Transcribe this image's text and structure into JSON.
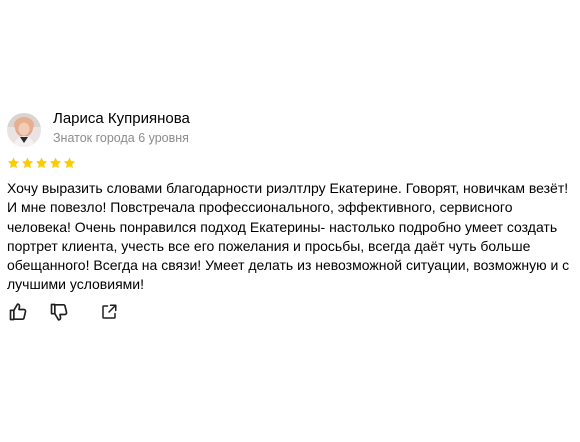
{
  "review": {
    "author": {
      "name": "Лариса Куприянова",
      "level": "Знаток города 6 уровня"
    },
    "rating": 5,
    "star_color": "#fccc00",
    "text": "Хочу выразить словами благодарности риэлтлру Екатерине. Говорят, новичкам везёт! И мне повезло! Повстречала профессионального, эффективного, сервисного человека! Очень понравился подход Екатерины- настолько подробно умеет создать портрет клиента, учесть все его пожелания и просьбы, всегда даёт чуть больше обещанного! Всегда на связи! Умеет делать из невозможной ситуации, возможную и с лучшими условиями!",
    "actions": {
      "like_icon": "thumbs-up-icon",
      "dislike_icon": "thumbs-down-icon",
      "share_icon": "share-icon"
    }
  }
}
